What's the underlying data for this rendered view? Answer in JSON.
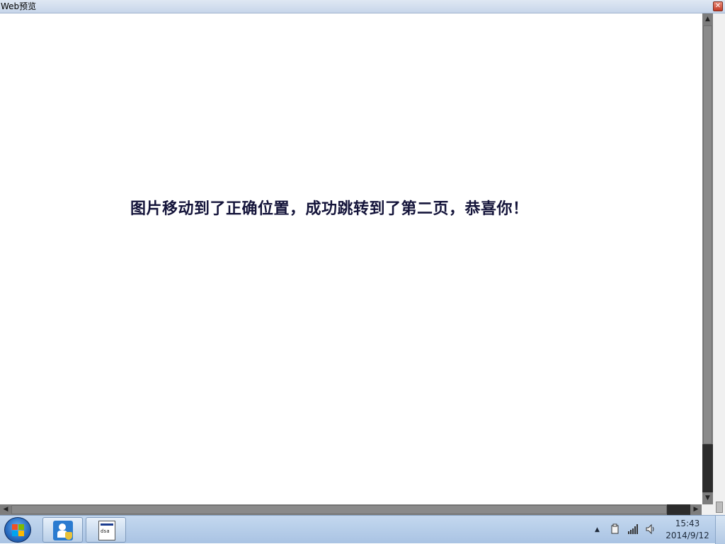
{
  "window": {
    "title": "Web预览",
    "close_glyph": "✕"
  },
  "content": {
    "message": "图片移动到了正确位置，成功跳转到了第二页，恭喜你！"
  },
  "scrollbars": {
    "up_glyph": "▲",
    "down_glyph": "▼",
    "left_glyph": "◀",
    "right_glyph": "▶"
  },
  "taskbar": {
    "start_icon": "windows-start-orb",
    "items": [
      {
        "icon": "user-account-control-icon"
      },
      {
        "icon": "web-document-icon",
        "thumb_text": "dsa"
      }
    ],
    "tray": {
      "show_hidden_glyph": "▲",
      "clock_time": "15:43",
      "clock_date": "2014/9/12"
    }
  }
}
